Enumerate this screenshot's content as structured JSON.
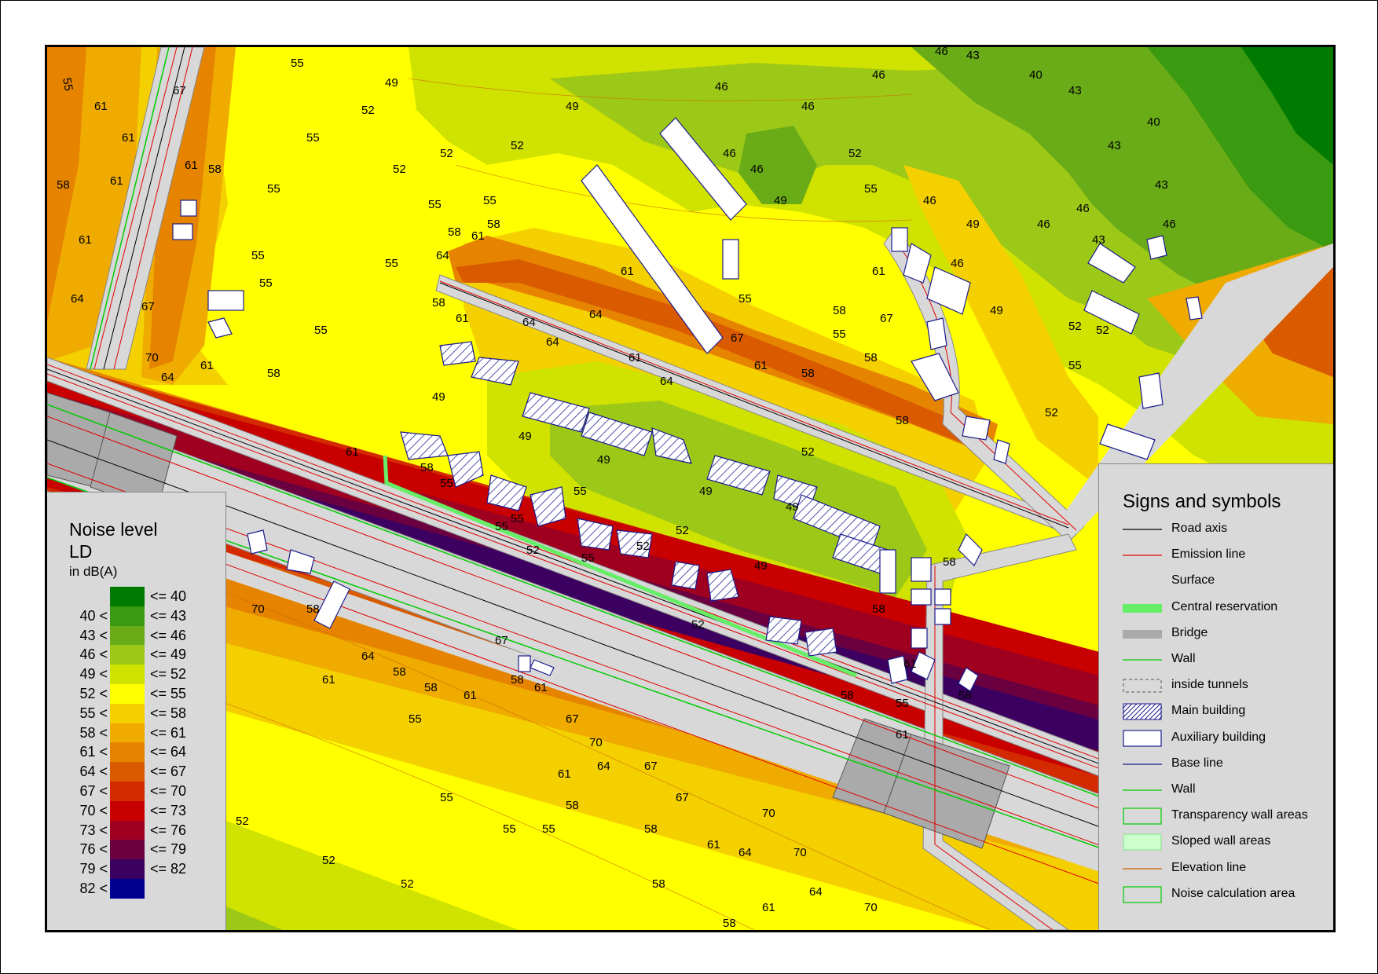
{
  "noise_legend": {
    "title_line1": "Noise level",
    "title_line2": "LD",
    "unit": "in dB(A)",
    "classes": [
      {
        "lower": "",
        "upper": "<= 40",
        "color": "#007a00"
      },
      {
        "lower": "40 <",
        "upper": "<= 43",
        "color": "#3a9a10"
      },
      {
        "lower": "43 <",
        "upper": "<= 46",
        "color": "#6aac18"
      },
      {
        "lower": "46 <",
        "upper": "<= 49",
        "color": "#9cc818"
      },
      {
        "lower": "49 <",
        "upper": "<= 52",
        "color": "#cfe200"
      },
      {
        "lower": "52 <",
        "upper": "<= 55",
        "color": "#ffff00"
      },
      {
        "lower": "55 <",
        "upper": "<= 58",
        "color": "#f5d000"
      },
      {
        "lower": "58 <",
        "upper": "<= 61",
        "color": "#efab00"
      },
      {
        "lower": "61 <",
        "upper": "<= 64",
        "color": "#e68400"
      },
      {
        "lower": "64 <",
        "upper": "<= 67",
        "color": "#da5a00"
      },
      {
        "lower": "67 <",
        "upper": "<= 70",
        "color": "#d42a00"
      },
      {
        "lower": "70 <",
        "upper": "<= 73",
        "color": "#c80000"
      },
      {
        "lower": "73 <",
        "upper": "<= 76",
        "color": "#a00020"
      },
      {
        "lower": "76 <",
        "upper": "<= 79",
        "color": "#6a0040"
      },
      {
        "lower": "79 <",
        "upper": "<= 82",
        "color": "#3c0060"
      },
      {
        "lower": "82 <",
        "upper": "",
        "color": "#000090"
      }
    ]
  },
  "symbols_legend": {
    "title": "Signs and symbols",
    "items": [
      {
        "label": "Road axis",
        "kind": "line",
        "color": "#000000"
      },
      {
        "label": "Emission line",
        "kind": "line",
        "color": "#e00000"
      },
      {
        "label": "Surface",
        "kind": "none",
        "color": ""
      },
      {
        "label": "Central reservation",
        "kind": "band",
        "color": "#66ee66"
      },
      {
        "label": "Bridge",
        "kind": "band",
        "color": "#aaaaaa"
      },
      {
        "label": "Wall",
        "kind": "line",
        "color": "#00cc00"
      },
      {
        "label": "inside tunnels",
        "kind": "dashed-box",
        "color": "#555555"
      },
      {
        "label": "Main building",
        "kind": "hatched-box",
        "color": "#1a1a8c"
      },
      {
        "label": "Auxiliary building",
        "kind": "box",
        "color": "#1a1a8c"
      },
      {
        "label": "Base line",
        "kind": "line",
        "color": "#1a1a8c"
      },
      {
        "label": "Wall",
        "kind": "line",
        "color": "#00cc00"
      },
      {
        "label": "Transparency wall areas",
        "kind": "green-box",
        "color": "#00cc00"
      },
      {
        "label": "Sloped wall areas",
        "kind": "filled-green-box",
        "color": "#ccffcc"
      },
      {
        "label": "Elevation line",
        "kind": "line",
        "color": "#cc6600"
      },
      {
        "label": "Noise calculation area",
        "kind": "green-box",
        "color": "#00cc00"
      }
    ]
  },
  "contour_labels": [
    "40",
    "43",
    "46",
    "49",
    "52",
    "55",
    "58",
    "61",
    "64",
    "67",
    "70"
  ]
}
